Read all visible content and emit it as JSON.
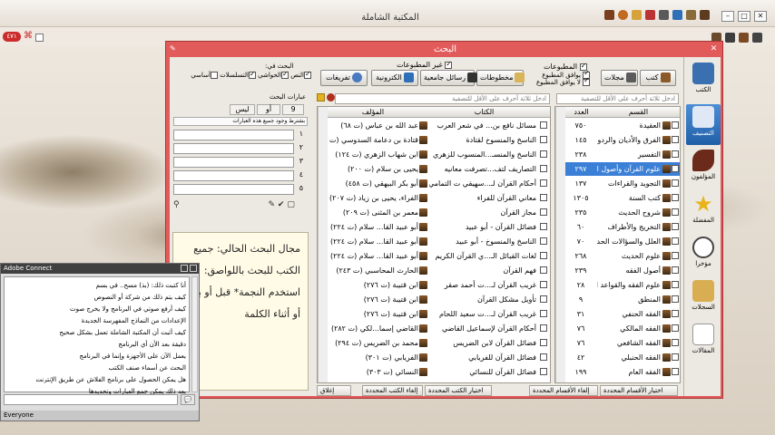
{
  "app": {
    "title": "المكتبة الشاملة",
    "page_badge": "٤٧١",
    "min_label": "–",
    "max_label": "□",
    "close_label": "✕"
  },
  "dialog": {
    "title": "البحث",
    "close_label": "✕",
    "pin_label": "✎"
  },
  "nav": [
    {
      "label": "الكتب",
      "icon": "books-icon",
      "color": "#3a6fb0"
    },
    {
      "label": "التصنيف",
      "icon": "book-stack-icon",
      "color": "#2a4f88"
    },
    {
      "label": "المؤلفون",
      "icon": "quill-icon",
      "color": "#6b2a1a"
    },
    {
      "label": "المفضلة",
      "icon": "star-icon",
      "color": "#e8b21a"
    },
    {
      "label": "مؤخرا",
      "icon": "clock-icon",
      "color": "#444444"
    },
    {
      "label": "السجلات",
      "icon": "scroll-icon",
      "color": "#c99a3b"
    },
    {
      "label": "المقالات",
      "icon": "pen-paper-icon",
      "color": "#7a7a7a"
    }
  ],
  "filters": {
    "printed_label": "المطبوعات",
    "unprinted_label": "غير المطبوعات",
    "matches_printed": "يوافق المطبوع",
    "not_matches_printed": "لا يوافق المطبوع",
    "search_in": "البحث في:",
    "options": [
      "النص",
      "الحواشي",
      "التسلسلات",
      "أساسي"
    ],
    "buttons": [
      "كتب",
      "مجلات",
      "مخطوطات",
      "رسائل جامعية",
      "الكترونية",
      "تفريغات"
    ]
  },
  "search_terms": {
    "label": "عبارات البحث",
    "tabs": [
      "9",
      "أو",
      "ليس"
    ],
    "hint": "بشترط وجود جميع هذه العبارات",
    "numbers": [
      "١",
      "٢",
      "٣",
      "٤",
      "٥"
    ]
  },
  "info_text": "مجال البحث الحالي: جميع الكتب للبحث باللواصق: استخدم النجمة* قبل أو بعد أو أثناء الكلمة",
  "categories": {
    "filter_placeholder": "ادخل ثلاثة أحرف على الأقل للتصفية",
    "col_name": "القسم",
    "col_count": "العدد",
    "rows": [
      {
        "name": "العقيدة",
        "count": "٧٥٠"
      },
      {
        "name": "الفرق والأديان والردود",
        "count": "١٤٥"
      },
      {
        "name": "التفسير",
        "count": "٢٣٨"
      },
      {
        "name": "علوم القرآن وأصول التفسير",
        "count": "٢٩٧"
      },
      {
        "name": "التجويد والقراءات",
        "count": "١٣٧"
      },
      {
        "name": "كتب السنة",
        "count": "١٣٠٥"
      },
      {
        "name": "شروح الحديث",
        "count": "٢٣٥"
      },
      {
        "name": "التخريج والأطراف",
        "count": "٦٠"
      },
      {
        "name": "العلل والسؤالات الحديثية",
        "count": "٧٠"
      },
      {
        "name": "علوم الحديث",
        "count": "٢٦٨"
      },
      {
        "name": "أصول الفقه",
        "count": "٢٣٩"
      },
      {
        "name": "علوم الفقه والقواعد الفقهية",
        "count": "٢٨"
      },
      {
        "name": "المنطق",
        "count": "٩"
      },
      {
        "name": "الفقه الحنفي",
        "count": "٣١"
      },
      {
        "name": "الفقه المالكي",
        "count": "٧٦"
      },
      {
        "name": "الفقه الشافعي",
        "count": "٧٦"
      },
      {
        "name": "الفقه الحنبلي",
        "count": "٤٢"
      },
      {
        "name": "الفقه العام",
        "count": "١٩٩"
      }
    ]
  },
  "books": {
    "filter_placeholder": "ادخل ثلاثة أحرف على الأقل للتصفية",
    "col_title": "الكتاب",
    "col_author": "المؤلف",
    "rows": [
      {
        "title": "مسائل نافع بن... في شعر العرب",
        "author": "عبد الله بن عباس (ت ٦٨)"
      },
      {
        "title": "الناسخ والمنسوخ لقتادة",
        "author": "قتادة بن دعامة السدوسي (ت ١١٧)"
      },
      {
        "title": "الناسخ والمنسـ...المنسوب للزهري",
        "author": "ابن شهاب الزهري (ت ١٢٤)"
      },
      {
        "title": "التصاريف لتف...تصرفت معانيه",
        "author": "يحيى بن سلام (ت ٢٠٠)"
      },
      {
        "title": "أحكام القرآن لـ...سهيقي ت التمامي",
        "author": "أبو بكر البيهقي (ت ٤٥٨)"
      },
      {
        "title": "معاني القرآن للفراء",
        "author": "الفراء، يحيى بن زياد (ت ٢٠٧)"
      },
      {
        "title": "مجاز القرآن",
        "author": "معمر بن المثنى (ت ٢٠٩)"
      },
      {
        "title": "فضائل القرآن - أبو عبيد",
        "author": "أبو عبيد القا... سلام (ت ٢٢٤)"
      },
      {
        "title": "الناسخ والمنسوخ - أبو عبيد",
        "author": "أبو عبيد القا... سلام (ت ٢٢٤)"
      },
      {
        "title": "لغات القبائل الـ...ي القرآن الكريم",
        "author": "أبو عبيد القا... سلام (ت ٢٢٤)"
      },
      {
        "title": "فهم القرآن",
        "author": "الحارث المحاسبي (ت ٢٤٣)"
      },
      {
        "title": "غريب القرآن لـ...ت أحمد صقر",
        "author": "ابن قتيبة (ت ٢٧٦)"
      },
      {
        "title": "تأويل مشكل القرآن",
        "author": "ابن قتيبة (ت ٢٧٦)"
      },
      {
        "title": "غريب القرآن لـ...ت سعيد اللحام",
        "author": "ابن قتيبة (ت ٢٧٦)"
      },
      {
        "title": "أحكام القرآن لإسماعيل القاضي",
        "author": "القاضي إسما...لكي (ت ٢٨٢)"
      },
      {
        "title": "فضائل القرآن لابن الضريس",
        "author": "محمد بن الضريس (ت ٢٩٤)"
      },
      {
        "title": "فضائل القرآن للفريابي",
        "author": "الفريابي (ت ٣٠١)"
      },
      {
        "title": "فضائل القرآن للنسائي",
        "author": "النسائي (ت ٣٠٣)"
      }
    ]
  },
  "bottom_buttons": {
    "select_categories": "اختيار الأقسام المحددة",
    "clear_categories": "إلغاء الأقسام المحددة",
    "select_books": "اختيار الكتب المحددة",
    "clear_books": "إلغاء الكتب المحددة",
    "close": "إغلاق"
  },
  "adobe": {
    "title": "Adobe Connect",
    "messages": [
      "أنا كتبت ذلك: (بذ) مسح.. في بسم",
      "كيف يتم ذلك من شركة أو النصوص",
      "كيف أرفع صوتي في البرنامج ولا يخرج صوت",
      "الإعدادات من النماذج المفهرسة الجديدة",
      "كيف أثبت أن المكتبة الشاملة تعمل بشكل صحيح",
      "دقيقة بعد الأن أي البرنامج",
      "يعمل الآن على الأجهزة وإنما في البرنامج",
      "البحث عن أسماء صنف الكتب",
      "هل يمكن الحصول على برنامج الفلاش عن طريق الإنترنت",
      "بعد ذلك يمكن جمع العبارات وتحديدها"
    ],
    "send_label": "💬",
    "footer": "Everyone",
    "watermark": "/thoolabd"
  }
}
